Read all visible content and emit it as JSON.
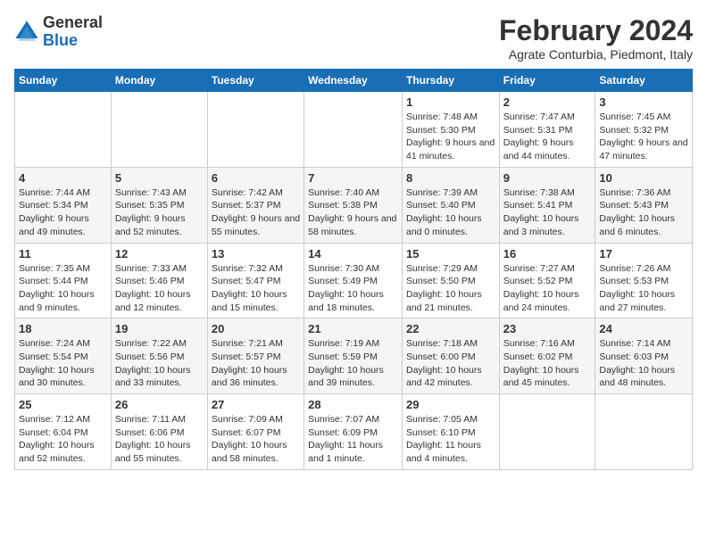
{
  "logo": {
    "general": "General",
    "blue": "Blue"
  },
  "header": {
    "month": "February 2024",
    "location": "Agrate Conturbia, Piedmont, Italy"
  },
  "weekdays": [
    "Sunday",
    "Monday",
    "Tuesday",
    "Wednesday",
    "Thursday",
    "Friday",
    "Saturday"
  ],
  "weeks": [
    [
      {
        "day": "",
        "info": ""
      },
      {
        "day": "",
        "info": ""
      },
      {
        "day": "",
        "info": ""
      },
      {
        "day": "",
        "info": ""
      },
      {
        "day": "1",
        "info": "Sunrise: 7:48 AM\nSunset: 5:30 PM\nDaylight: 9 hours and 41 minutes."
      },
      {
        "day": "2",
        "info": "Sunrise: 7:47 AM\nSunset: 5:31 PM\nDaylight: 9 hours and 44 minutes."
      },
      {
        "day": "3",
        "info": "Sunrise: 7:45 AM\nSunset: 5:32 PM\nDaylight: 9 hours and 47 minutes."
      }
    ],
    [
      {
        "day": "4",
        "info": "Sunrise: 7:44 AM\nSunset: 5:34 PM\nDaylight: 9 hours and 49 minutes."
      },
      {
        "day": "5",
        "info": "Sunrise: 7:43 AM\nSunset: 5:35 PM\nDaylight: 9 hours and 52 minutes."
      },
      {
        "day": "6",
        "info": "Sunrise: 7:42 AM\nSunset: 5:37 PM\nDaylight: 9 hours and 55 minutes."
      },
      {
        "day": "7",
        "info": "Sunrise: 7:40 AM\nSunset: 5:38 PM\nDaylight: 9 hours and 58 minutes."
      },
      {
        "day": "8",
        "info": "Sunrise: 7:39 AM\nSunset: 5:40 PM\nDaylight: 10 hours and 0 minutes."
      },
      {
        "day": "9",
        "info": "Sunrise: 7:38 AM\nSunset: 5:41 PM\nDaylight: 10 hours and 3 minutes."
      },
      {
        "day": "10",
        "info": "Sunrise: 7:36 AM\nSunset: 5:43 PM\nDaylight: 10 hours and 6 minutes."
      }
    ],
    [
      {
        "day": "11",
        "info": "Sunrise: 7:35 AM\nSunset: 5:44 PM\nDaylight: 10 hours and 9 minutes."
      },
      {
        "day": "12",
        "info": "Sunrise: 7:33 AM\nSunset: 5:46 PM\nDaylight: 10 hours and 12 minutes."
      },
      {
        "day": "13",
        "info": "Sunrise: 7:32 AM\nSunset: 5:47 PM\nDaylight: 10 hours and 15 minutes."
      },
      {
        "day": "14",
        "info": "Sunrise: 7:30 AM\nSunset: 5:49 PM\nDaylight: 10 hours and 18 minutes."
      },
      {
        "day": "15",
        "info": "Sunrise: 7:29 AM\nSunset: 5:50 PM\nDaylight: 10 hours and 21 minutes."
      },
      {
        "day": "16",
        "info": "Sunrise: 7:27 AM\nSunset: 5:52 PM\nDaylight: 10 hours and 24 minutes."
      },
      {
        "day": "17",
        "info": "Sunrise: 7:26 AM\nSunset: 5:53 PM\nDaylight: 10 hours and 27 minutes."
      }
    ],
    [
      {
        "day": "18",
        "info": "Sunrise: 7:24 AM\nSunset: 5:54 PM\nDaylight: 10 hours and 30 minutes."
      },
      {
        "day": "19",
        "info": "Sunrise: 7:22 AM\nSunset: 5:56 PM\nDaylight: 10 hours and 33 minutes."
      },
      {
        "day": "20",
        "info": "Sunrise: 7:21 AM\nSunset: 5:57 PM\nDaylight: 10 hours and 36 minutes."
      },
      {
        "day": "21",
        "info": "Sunrise: 7:19 AM\nSunset: 5:59 PM\nDaylight: 10 hours and 39 minutes."
      },
      {
        "day": "22",
        "info": "Sunrise: 7:18 AM\nSunset: 6:00 PM\nDaylight: 10 hours and 42 minutes."
      },
      {
        "day": "23",
        "info": "Sunrise: 7:16 AM\nSunset: 6:02 PM\nDaylight: 10 hours and 45 minutes."
      },
      {
        "day": "24",
        "info": "Sunrise: 7:14 AM\nSunset: 6:03 PM\nDaylight: 10 hours and 48 minutes."
      }
    ],
    [
      {
        "day": "25",
        "info": "Sunrise: 7:12 AM\nSunset: 6:04 PM\nDaylight: 10 hours and 52 minutes."
      },
      {
        "day": "26",
        "info": "Sunrise: 7:11 AM\nSunset: 6:06 PM\nDaylight: 10 hours and 55 minutes."
      },
      {
        "day": "27",
        "info": "Sunrise: 7:09 AM\nSunset: 6:07 PM\nDaylight: 10 hours and 58 minutes."
      },
      {
        "day": "28",
        "info": "Sunrise: 7:07 AM\nSunset: 6:09 PM\nDaylight: 11 hours and 1 minute."
      },
      {
        "day": "29",
        "info": "Sunrise: 7:05 AM\nSunset: 6:10 PM\nDaylight: 11 hours and 4 minutes."
      },
      {
        "day": "",
        "info": ""
      },
      {
        "day": "",
        "info": ""
      }
    ]
  ]
}
